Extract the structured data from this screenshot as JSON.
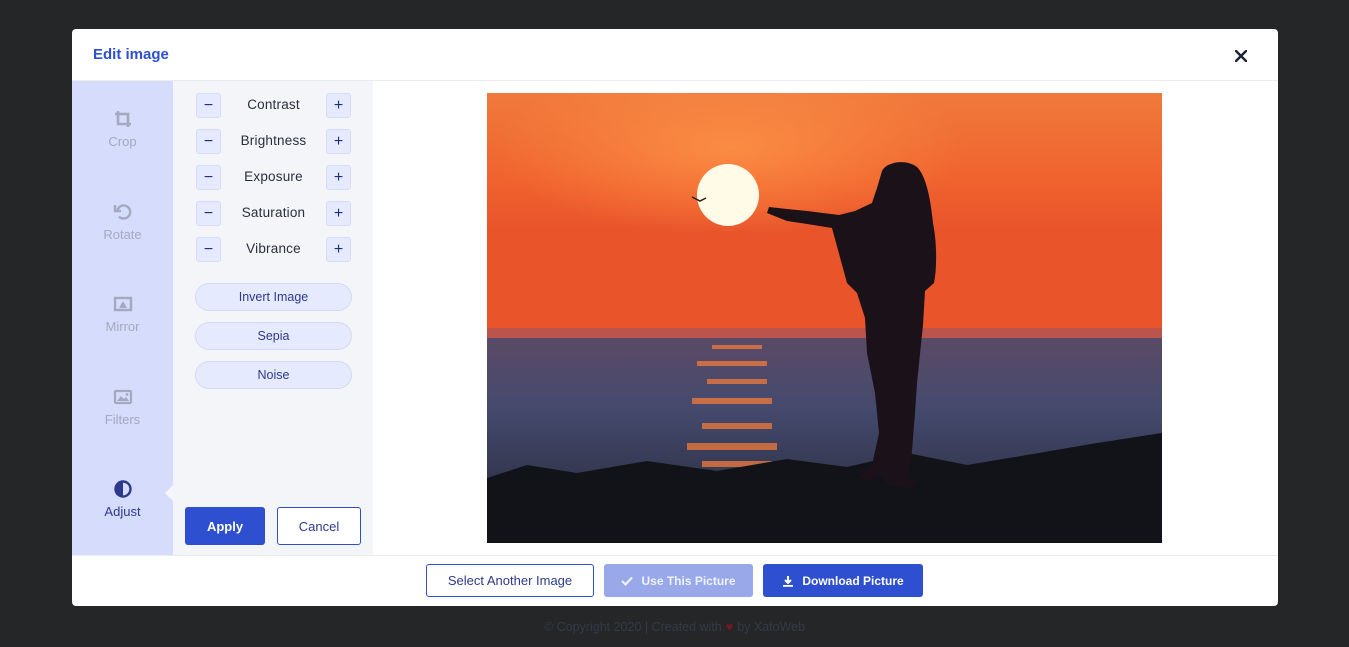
{
  "modal": {
    "title": "Edit image",
    "close_icon": "close-icon"
  },
  "sidebar": {
    "items": [
      {
        "label": "Crop",
        "icon": "crop-icon",
        "active": false
      },
      {
        "label": "Rotate",
        "icon": "rotate-icon",
        "active": false
      },
      {
        "label": "Mirror",
        "icon": "mirror-icon",
        "active": false
      },
      {
        "label": "Filters",
        "icon": "image-icon",
        "active": false
      },
      {
        "label": "Adjust",
        "icon": "contrast-icon",
        "active": true
      }
    ]
  },
  "adjust": {
    "sliders": [
      {
        "label": "Contrast"
      },
      {
        "label": "Brightness"
      },
      {
        "label": "Exposure"
      },
      {
        "label": "Saturation"
      },
      {
        "label": "Vibrance"
      }
    ],
    "minus_symbol": "−",
    "plus_symbol": "+",
    "effects": [
      "Invert Image",
      "Sepia",
      "Noise"
    ],
    "apply_label": "Apply",
    "cancel_label": "Cancel"
  },
  "footer": {
    "select_label": "Select Another Image",
    "use_label": "Use This Picture",
    "download_label": "Download Picture"
  },
  "copyright": {
    "prefix": "© Copyright 2020 | Created with",
    "suffix": "by XatoWeb"
  },
  "colors": {
    "accent": "#2d4fd0",
    "sidebar_bg": "#d6dcfb",
    "page_bg": "#252628"
  }
}
